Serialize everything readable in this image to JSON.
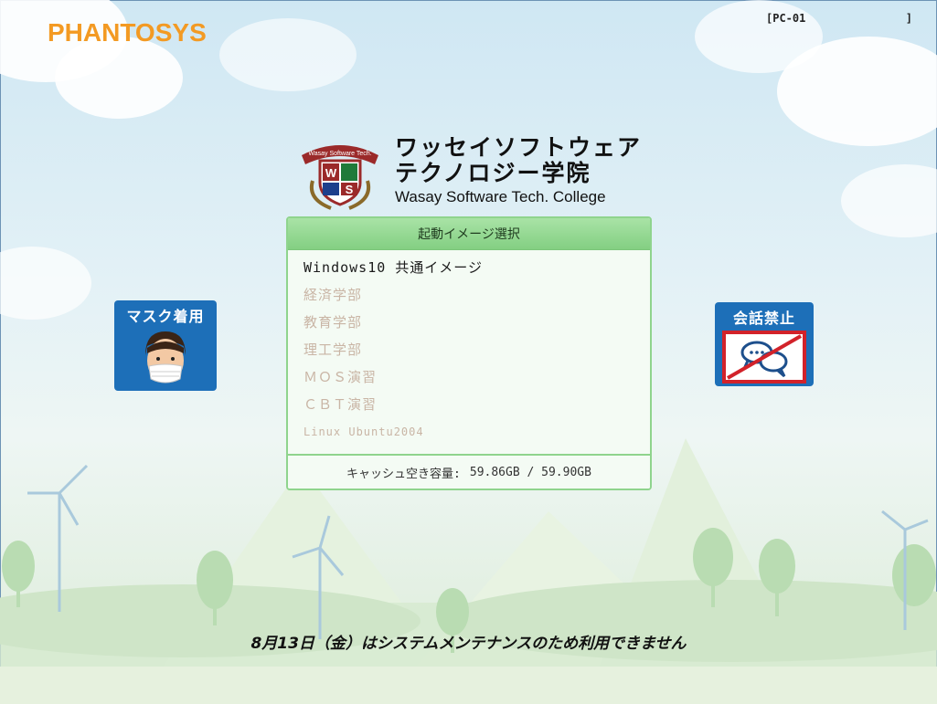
{
  "brand": {
    "name": "PHANTOSYS"
  },
  "machine": {
    "id_open": "[PC-01",
    "id_close": "]"
  },
  "school": {
    "name_line1": "ワッセイソフトウェア",
    "name_line2": "テクノロジー学院",
    "name_en": "Wasay Software Tech. College",
    "emblem_arc": "Wasay Software Tech.",
    "emblem_letters": [
      "W",
      "S"
    ]
  },
  "boot_panel": {
    "title": "起動イメージ選択",
    "items": [
      {
        "label": "Windows10 共通イメージ",
        "state": "enabled"
      },
      {
        "label": "経済学部",
        "state": "disabled"
      },
      {
        "label": "教育学部",
        "state": "disabled"
      },
      {
        "label": "理工学部",
        "state": "disabled"
      },
      {
        "label": "ＭＯＳ演習",
        "state": "disabled"
      },
      {
        "label": "ＣＢＴ演習",
        "state": "disabled"
      },
      {
        "label": "Linux Ubuntu2004",
        "state": "disabled"
      }
    ],
    "cache_label": "キャッシュ空き容量:",
    "cache_value": "59.86GB / 59.90GB"
  },
  "signs": {
    "mask": "マスク着用",
    "no_talk": "会話禁止"
  },
  "notice": "8月13日（金）はシステムメンテナンスのため利用できません",
  "colors": {
    "brand_orange": "#f39a23",
    "panel_green": "#8fd48d",
    "sign_blue": "#1d6fb8",
    "emblem_red": "#9b2a2a"
  }
}
